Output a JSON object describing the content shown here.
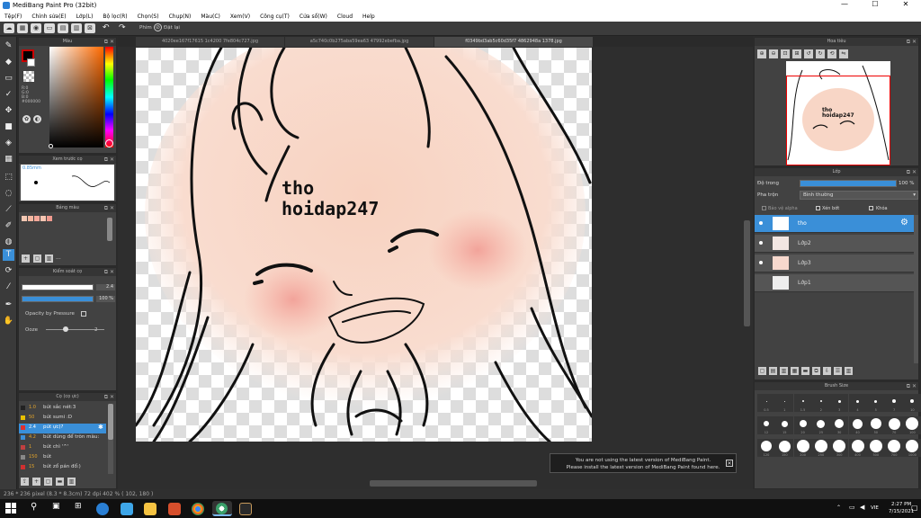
{
  "window": {
    "title": "MediBang Paint Pro (32bit)",
    "minimize": "—",
    "maximize": "☐",
    "close": "✕"
  },
  "menu": [
    "Tệp(F)",
    "Chỉnh sửa(E)",
    "Lớp(L)",
    "Bộ lọc(R)",
    "Chọn(S)",
    "Chụp(N)",
    "Màu(C)",
    "Xem(V)",
    "Công cụ(T)",
    "Cửa sổ(W)",
    "Cloud",
    "Help"
  ],
  "toolbar": {
    "pen_label": "Phím",
    "eraser_label": "Đặt lại"
  },
  "tabs": [
    "4020ee167f17615 1c4200 7fe804c727.jpg",
    "a5c740c0b275aba59ea63 47992ebefba.jpg",
    "f0349bd3ab5c60d35f7 4862948a 1378.jpg"
  ],
  "color_panel": {
    "title": "Màu",
    "r": "R:0",
    "g": "G:0",
    "b": "B:0",
    "hex": "#000000"
  },
  "brush_preview": {
    "title": "Xem trước cọ",
    "size": "0.85mm"
  },
  "palette": {
    "title": "Bảng màu",
    "swatches": [
      "#f3c8b3",
      "#f5b7a0",
      "#f5a89a",
      "#f7c5b2",
      "#f09a8f"
    ]
  },
  "brush_control": {
    "title": "Kiểm soát cọ",
    "size_value": "2.4",
    "opacity_value": "100 %",
    "pressure_label": "Opacity by Pressure",
    "ooze_label": "Ooze",
    "ooze_value": "2"
  },
  "brush_list": {
    "title": "Cọ (cọ ực)",
    "items": [
      {
        "size": "1.0",
        "name": "bút sắc nét:3",
        "color": "#222222"
      },
      {
        "size": "50",
        "name": "bút sumi :D",
        "color": "#e8c000"
      },
      {
        "size": "2.4",
        "name": "pút ực)?",
        "color": "#e03030"
      },
      {
        "size": "4.2",
        "name": "bút dùng để tròn màu:",
        "color": "#3a8fd8"
      },
      {
        "size": "1",
        "name": "bút chì '^'",
        "color": "#c04040"
      },
      {
        "size": "150",
        "name": "bút",
        "color": "#888888"
      },
      {
        "size": "15",
        "name": "bút zổ pán đổ:)",
        "color": "#d03030"
      }
    ]
  },
  "navigator": {
    "title": "Hoa tiêu"
  },
  "layer_panel": {
    "title": "Lớp",
    "opacity_label": "Độ trong",
    "opacity_value": "100 %",
    "blend_label": "Pha trộn",
    "blend_value": "Bình thường",
    "protect_alpha": "Bảo vệ alpha",
    "clipping": "Xén bớt",
    "lock": "Khóa",
    "layers": [
      {
        "name": "tho",
        "active": true
      },
      {
        "name": "Lớp2",
        "active": false
      },
      {
        "name": "Lớp3",
        "active": false
      },
      {
        "name": "Lớp1",
        "active": false
      }
    ]
  },
  "brush_size_panel": {
    "title": "Brush Size",
    "row1": [
      "0.5",
      "1",
      "1.5",
      "2",
      "3",
      "4",
      "5",
      "7",
      "10"
    ],
    "row2": [
      "12",
      "15",
      "20",
      "25",
      "30",
      "40",
      "50",
      "70",
      "100"
    ],
    "row3": [
      "120",
      "150",
      "200",
      "250",
      "300",
      "400",
      "500",
      "700",
      "1000"
    ]
  },
  "canvas_text": {
    "line1": "tho",
    "line2": "hoidap247"
  },
  "notice": {
    "line1": "You are not using the latest version of MediBang Paint.",
    "line2": "Please install the latest version of MediBang Paint found here."
  },
  "status": {
    "text": "236 * 236 pixel   (8.3 * 8.3cm)   72 dpi   402 %   ( 102, 180 )"
  },
  "taskbar": {
    "lang": "VIE",
    "time": "2:27 PM",
    "date": "7/15/2021"
  }
}
